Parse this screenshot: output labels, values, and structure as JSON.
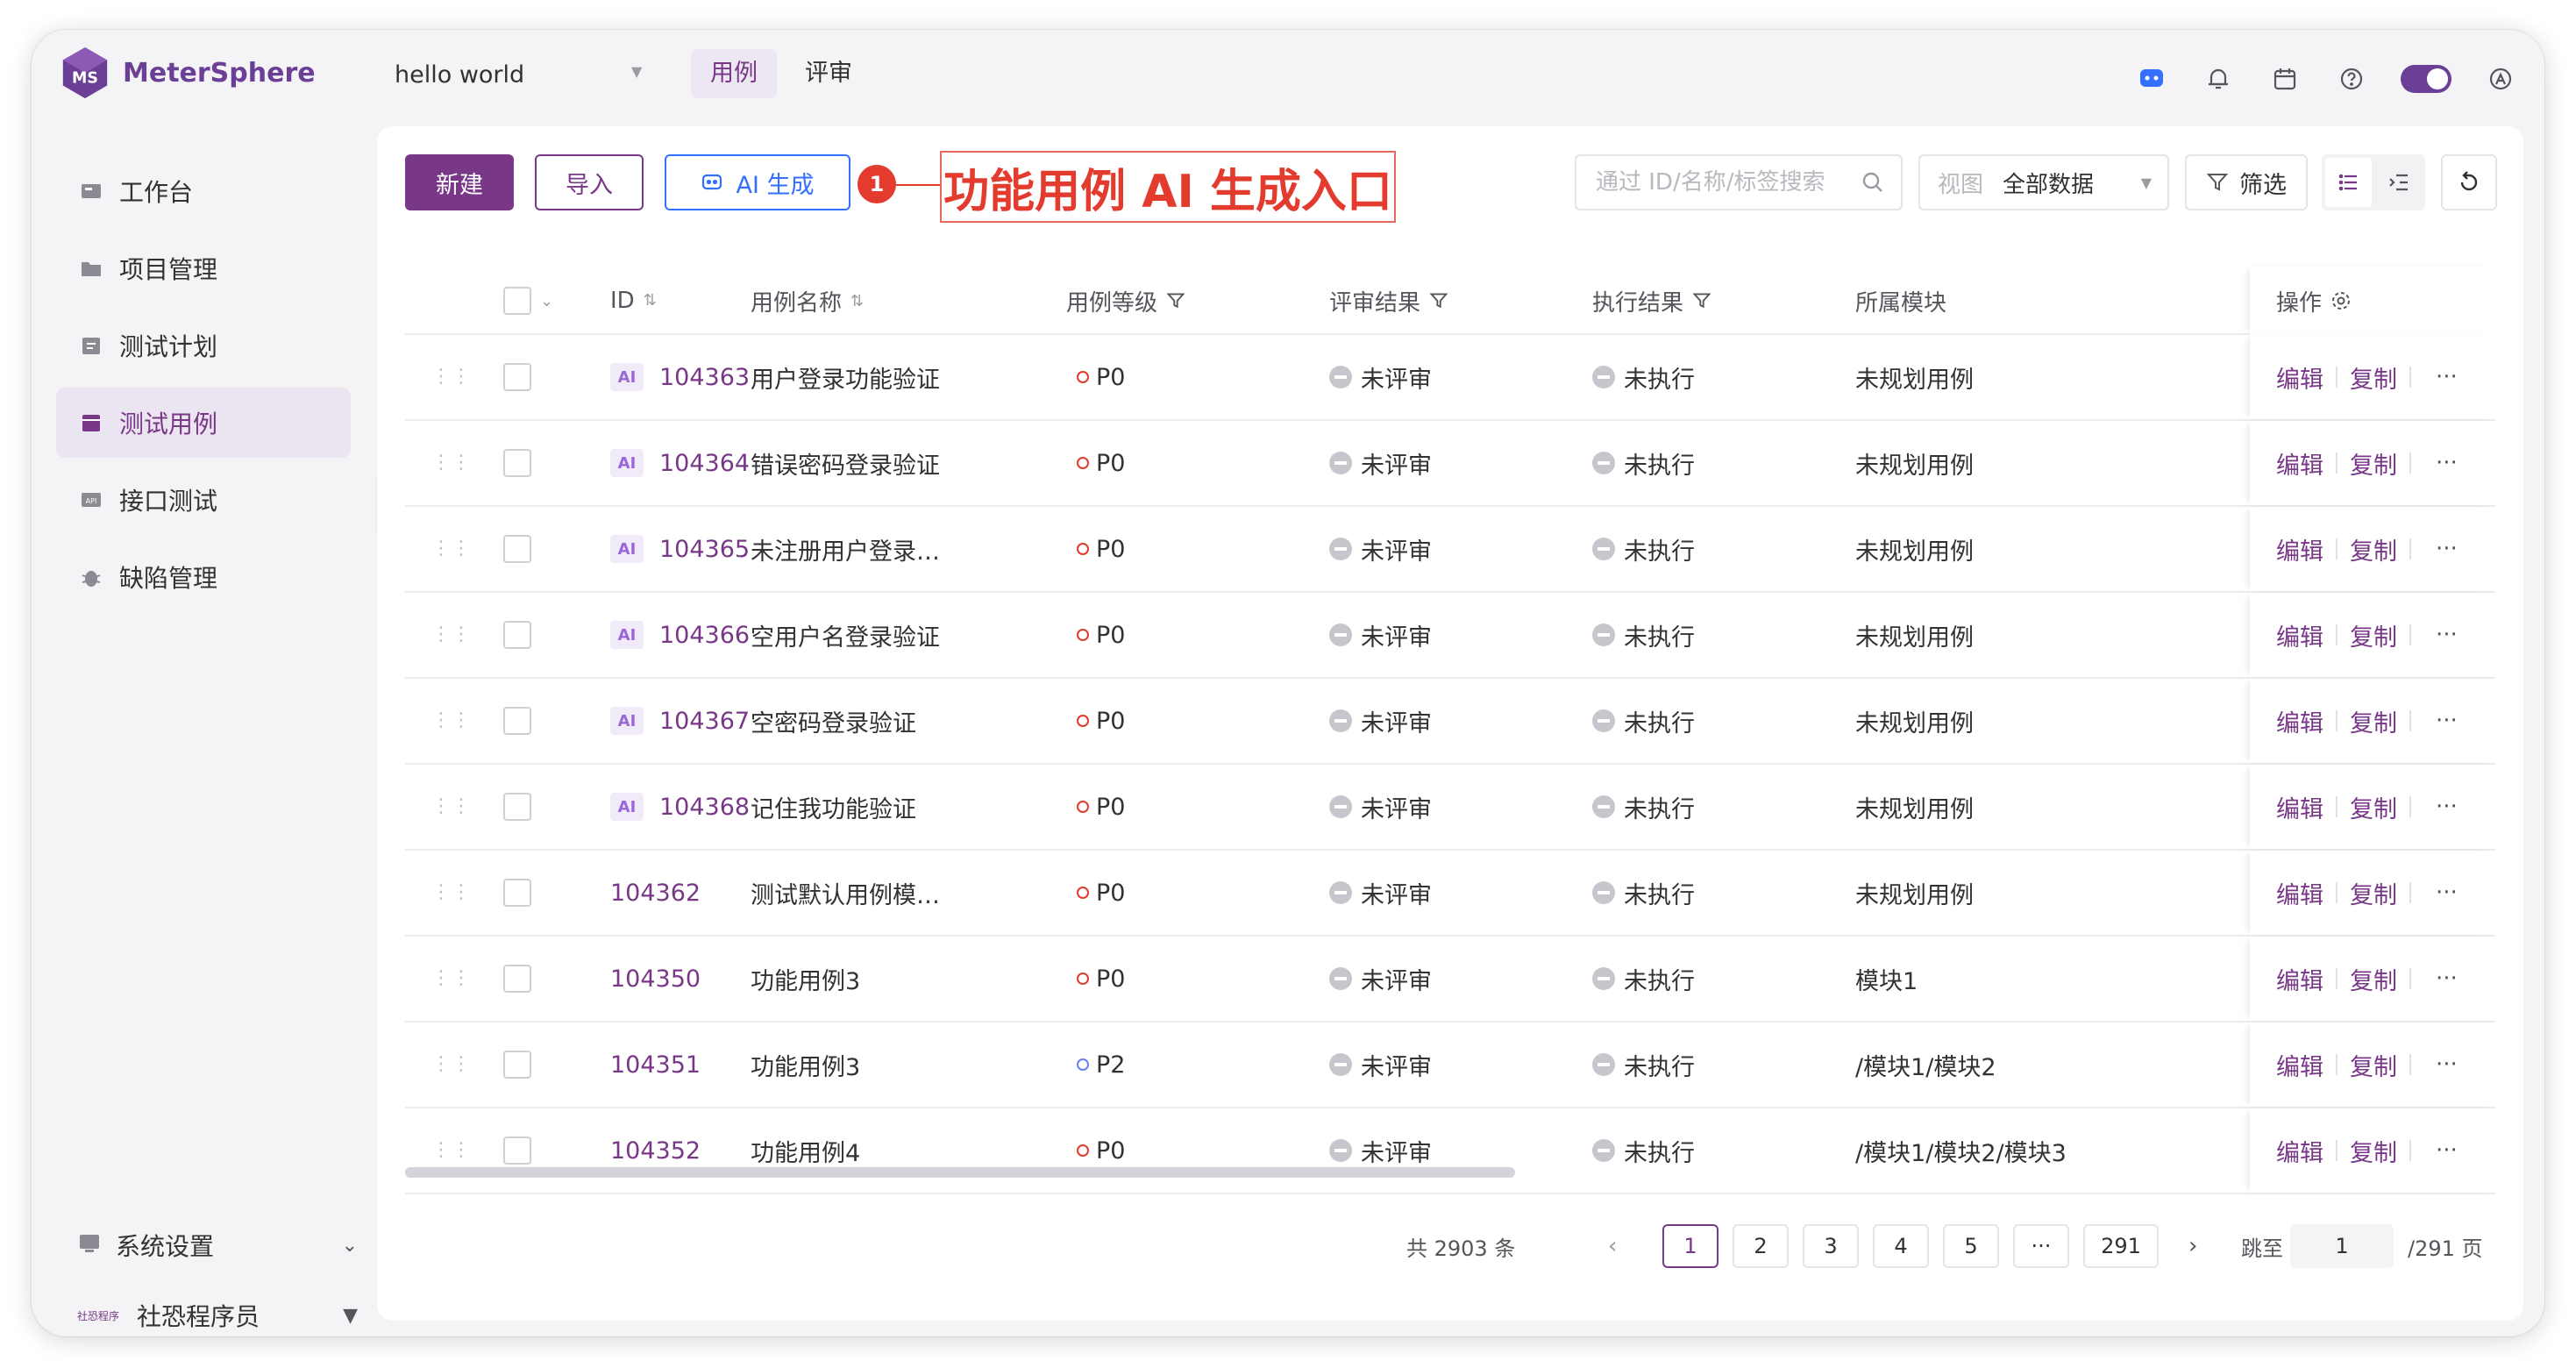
{
  "app": {
    "name": "MeterSphere",
    "project": "hello world"
  },
  "top_tabs": [
    {
      "label": "用例",
      "active": true
    },
    {
      "label": "评审",
      "active": false
    }
  ],
  "top_icons": [
    "ai-assistant-icon",
    "bell-icon",
    "calendar-icon",
    "help-icon",
    "theme-toggle",
    "user-icon"
  ],
  "sidebar": {
    "items": [
      {
        "label": "工作台",
        "icon": "workbench-icon",
        "active": false
      },
      {
        "label": "项目管理",
        "icon": "project-icon",
        "active": false
      },
      {
        "label": "测试计划",
        "icon": "plan-icon",
        "active": false
      },
      {
        "label": "测试用例",
        "icon": "case-icon",
        "active": true
      },
      {
        "label": "接口测试",
        "icon": "api-icon",
        "active": false
      },
      {
        "label": "缺陷管理",
        "icon": "bug-icon",
        "active": false
      }
    ],
    "system_settings": "系统设置",
    "org_label": "社恐程序",
    "user_name": "社恐程序员"
  },
  "toolbar": {
    "new_label": "新建",
    "import_label": "导入",
    "ai_label": "AI 生成",
    "callout_number": "1",
    "callout_text": "功能用例 AI 生成入口",
    "search_placeholder": "通过 ID/名称/标签搜索",
    "view_label": "视图",
    "view_value": "全部数据",
    "filter_label": "筛选"
  },
  "table": {
    "headers": {
      "id": "ID",
      "name": "用例名称",
      "level": "用例等级",
      "review": "评审结果",
      "exec": "执行结果",
      "module": "所属模块",
      "op": "操作"
    },
    "rows": [
      {
        "ai": "AI",
        "id": "104363",
        "name": "用户登录功能验证",
        "level": "P0",
        "level_color": "#e33b2e",
        "review": "未评审",
        "exec": "未执行",
        "module": "未规划用例"
      },
      {
        "ai": "AI",
        "id": "104364",
        "name": "错误密码登录验证",
        "level": "P0",
        "level_color": "#e33b2e",
        "review": "未评审",
        "exec": "未执行",
        "module": "未规划用例"
      },
      {
        "ai": "AI",
        "id": "104365",
        "name": "未注册用户登录…",
        "level": "P0",
        "level_color": "#e33b2e",
        "review": "未评审",
        "exec": "未执行",
        "module": "未规划用例"
      },
      {
        "ai": "AI",
        "id": "104366",
        "name": "空用户名登录验证",
        "level": "P0",
        "level_color": "#e33b2e",
        "review": "未评审",
        "exec": "未执行",
        "module": "未规划用例"
      },
      {
        "ai": "AI",
        "id": "104367",
        "name": "空密码登录验证",
        "level": "P0",
        "level_color": "#e33b2e",
        "review": "未评审",
        "exec": "未执行",
        "module": "未规划用例"
      },
      {
        "ai": "AI",
        "id": "104368",
        "name": "记住我功能验证",
        "level": "P0",
        "level_color": "#e33b2e",
        "review": "未评审",
        "exec": "未执行",
        "module": "未规划用例"
      },
      {
        "ai": "",
        "id": "104362",
        "name": "测试默认用例模…",
        "level": "P0",
        "level_color": "#e33b2e",
        "review": "未评审",
        "exec": "未执行",
        "module": "未规划用例"
      },
      {
        "ai": "",
        "id": "104350",
        "name": "功能用例3",
        "level": "P0",
        "level_color": "#e33b2e",
        "review": "未评审",
        "exec": "未执行",
        "module": "模块1"
      },
      {
        "ai": "",
        "id": "104351",
        "name": "功能用例3",
        "level": "P2",
        "level_color": "#6b7ff5",
        "review": "未评审",
        "exec": "未执行",
        "module": "/模块1/模块2"
      },
      {
        "ai": "",
        "id": "104352",
        "name": "功能用例4",
        "level": "P0",
        "level_color": "#e33b2e",
        "review": "未评审",
        "exec": "未执行",
        "module": "/模块1/模块2/模块3"
      }
    ],
    "op_edit": "编辑",
    "op_copy": "复制",
    "op_more": "···"
  },
  "pagination": {
    "total": "共 2903 条",
    "pages": [
      "1",
      "2",
      "3",
      "4",
      "5",
      "···",
      "291"
    ],
    "current": "1",
    "jump_label": "跳至",
    "jump_value": "1",
    "total_pages": "/291 页"
  },
  "colors": {
    "brand": "#783887",
    "ai_blue": "#3370ff",
    "callout_red": "#e33b2e"
  }
}
